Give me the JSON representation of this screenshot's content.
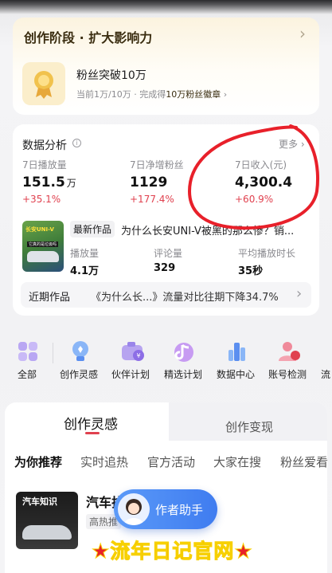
{
  "stage_card": {
    "title": "创作阶段 · 扩大影响力",
    "milestone_title": "粉丝突破10万",
    "milestone_desc_prefix": "当前1万/10万 · 完成得",
    "milestone_desc_highlight": "10万粉丝徽章",
    "chevron": "›"
  },
  "analytics": {
    "title": "数据分析",
    "more_label": "更多",
    "stats": [
      {
        "label": "7日播放量",
        "value": "151.5",
        "unit": "万",
        "change": "+35.1%"
      },
      {
        "label": "7日净增粉丝",
        "value": "1129",
        "unit": "",
        "change": "+177.4%"
      },
      {
        "label": "7日收入(元)",
        "value": "4,300.4",
        "unit": "",
        "change": "+60.9%"
      }
    ],
    "latest": {
      "badge": "最新作品",
      "title": "为什么长安UNI-V被黑的那么惨？销...",
      "thumb_text": "长安UNI-V",
      "thumb_sub": "它真的是垃圾吗",
      "metrics": [
        {
          "label": "播放量",
          "value": "4.1万"
        },
        {
          "label": "评论量",
          "value": "329"
        },
        {
          "label": "平均播放时长",
          "value": "35秒"
        }
      ]
    },
    "recent": {
      "label": "近期作品",
      "text": "《为什么长...》流量对比往期下降34.7%"
    }
  },
  "toolbar": {
    "items": [
      {
        "label": "全部",
        "icon": "grid-icon"
      },
      {
        "label": "创作灵感",
        "icon": "lightbulb-icon"
      },
      {
        "label": "伙伴计划",
        "icon": "coin-camera-icon"
      },
      {
        "label": "精选计划",
        "icon": "music-note-icon"
      },
      {
        "label": "数据中心",
        "icon": "bar-chart-icon"
      },
      {
        "label": "账号检测",
        "icon": "user-shield-icon"
      },
      {
        "label": "流",
        "icon": "partial-icon"
      }
    ]
  },
  "main_tabs": {
    "active": "创作灵感",
    "inactive": "创作变现"
  },
  "categories": [
    "为你推荐",
    "实时追热",
    "官方活动",
    "大家在搜",
    "粉丝爱看"
  ],
  "feed_item": {
    "title": "汽车排",
    "tag": "高热推",
    "thumb_text": "汽车知识"
  },
  "assistant": {
    "label": "作者助手"
  },
  "watermark": "★流年日记官网★",
  "colors": {
    "accent": "#e0414f",
    "gold": "#c8962a",
    "assistant_blue": "#4a8cf7",
    "annotation_red": "#e8202a"
  }
}
